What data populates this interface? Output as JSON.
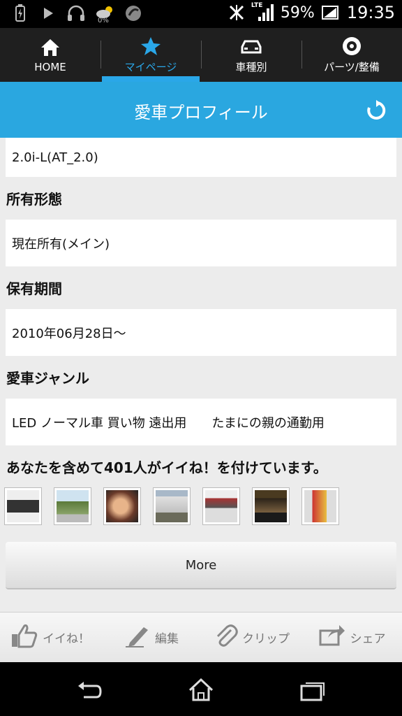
{
  "status_bar": {
    "battery_pct": "59%",
    "time": "19:35",
    "network": "LTE",
    "data_pct": "0%"
  },
  "nav": {
    "tabs": [
      {
        "label": "HOME",
        "icon": "home-icon"
      },
      {
        "label": "マイページ",
        "icon": "star-icon",
        "active": true
      },
      {
        "label": "車種別",
        "icon": "car-icon"
      },
      {
        "label": "パーツ/整備",
        "icon": "tire-icon"
      }
    ]
  },
  "header": {
    "title": "愛車プロフィール"
  },
  "profile": {
    "grade_value": "2.0i-L(AT_2.0)",
    "ownership_label": "所有形態",
    "ownership_value": "現在所有(メイン)",
    "period_label": "保有期間",
    "period_value": "2010年06月28日〜",
    "genre_label": "愛車ジャンル",
    "genre_value": "LED ノーマル車 買い物 遠出用　　たまにの親の通勤用"
  },
  "likes": {
    "text": "あなたを含めて401人がイイね！を付けています。"
  },
  "more_label": "More",
  "actions": [
    {
      "label": "イイね！",
      "icon": "thumbs-up-icon"
    },
    {
      "label": "編集",
      "icon": "pencil-icon"
    },
    {
      "label": "クリップ",
      "icon": "paperclip-icon"
    },
    {
      "label": "シェア",
      "icon": "share-icon"
    }
  ],
  "colors": {
    "accent": "#2aa7e0",
    "nav_bg": "#1f1f1f"
  }
}
